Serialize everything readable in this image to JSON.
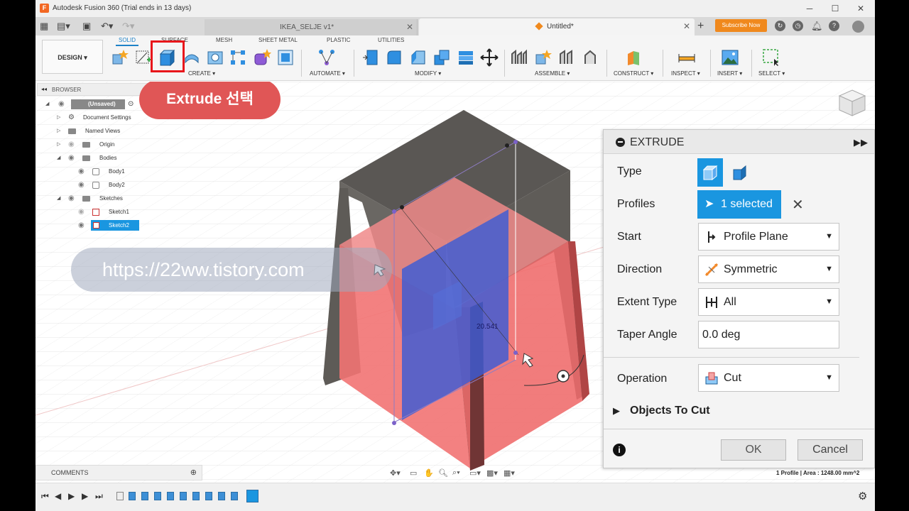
{
  "window": {
    "title": "Autodesk Fusion 360 (Trial ends in 13 days)",
    "controls": [
      "─",
      "☐",
      "✕"
    ]
  },
  "tabs": {
    "doc1": "IKEA_SELJE v1*",
    "doc2": "Untitled*",
    "subscribe": "Subscribe Now"
  },
  "toolbar": {
    "design": "DESIGN ▾",
    "workspaces": [
      "SOLID",
      "SURFACE",
      "MESH",
      "SHEET METAL",
      "PLASTIC",
      "UTILITIES"
    ],
    "groups": {
      "create": "CREATE ▾",
      "automate": "AUTOMATE ▾",
      "modify": "MODIFY ▾",
      "assemble": "ASSEMBLE ▾",
      "construct": "CONSTRUCT ▾",
      "inspect": "INSPECT ▾",
      "insert": "INSERT ▾",
      "select": "SELECT ▾"
    }
  },
  "browser": {
    "header": "BROWSER",
    "root": "(Unsaved)",
    "items": [
      "Document Settings",
      "Named Views",
      "Origin",
      "Bodies",
      "Body1",
      "Body2",
      "Sketches",
      "Sketch1",
      "Sketch2"
    ]
  },
  "callout": "Extrude 선택",
  "watermark": "https://22ww.tistory.com",
  "viewport": {
    "dimension": "20.541",
    "status": "1 Profile | Area : 1248.00 mm^2",
    "comments": "COMMENTS"
  },
  "extrude": {
    "title": "EXTRUDE",
    "type_label": "Type",
    "profiles_label": "Profiles",
    "profiles_value": "1 selected",
    "start_label": "Start",
    "start_value": "Profile Plane",
    "direction_label": "Direction",
    "direction_value": "Symmetric",
    "extent_label": "Extent Type",
    "extent_value": "All",
    "taper_label": "Taper Angle",
    "taper_value": "0.0 deg",
    "operation_label": "Operation",
    "operation_value": "Cut",
    "objects_label": "Objects To Cut",
    "ok": "OK",
    "cancel": "Cancel"
  },
  "colors": {
    "accent_blue": "#1a96e0",
    "highlight_red": "#e8161b",
    "callout_red": "#e05656",
    "cut_red": "#f06a6a",
    "profile_blue": "#3b5bd6",
    "body_gray": "#5f5c58",
    "subscribe_orange": "#f0891d"
  }
}
